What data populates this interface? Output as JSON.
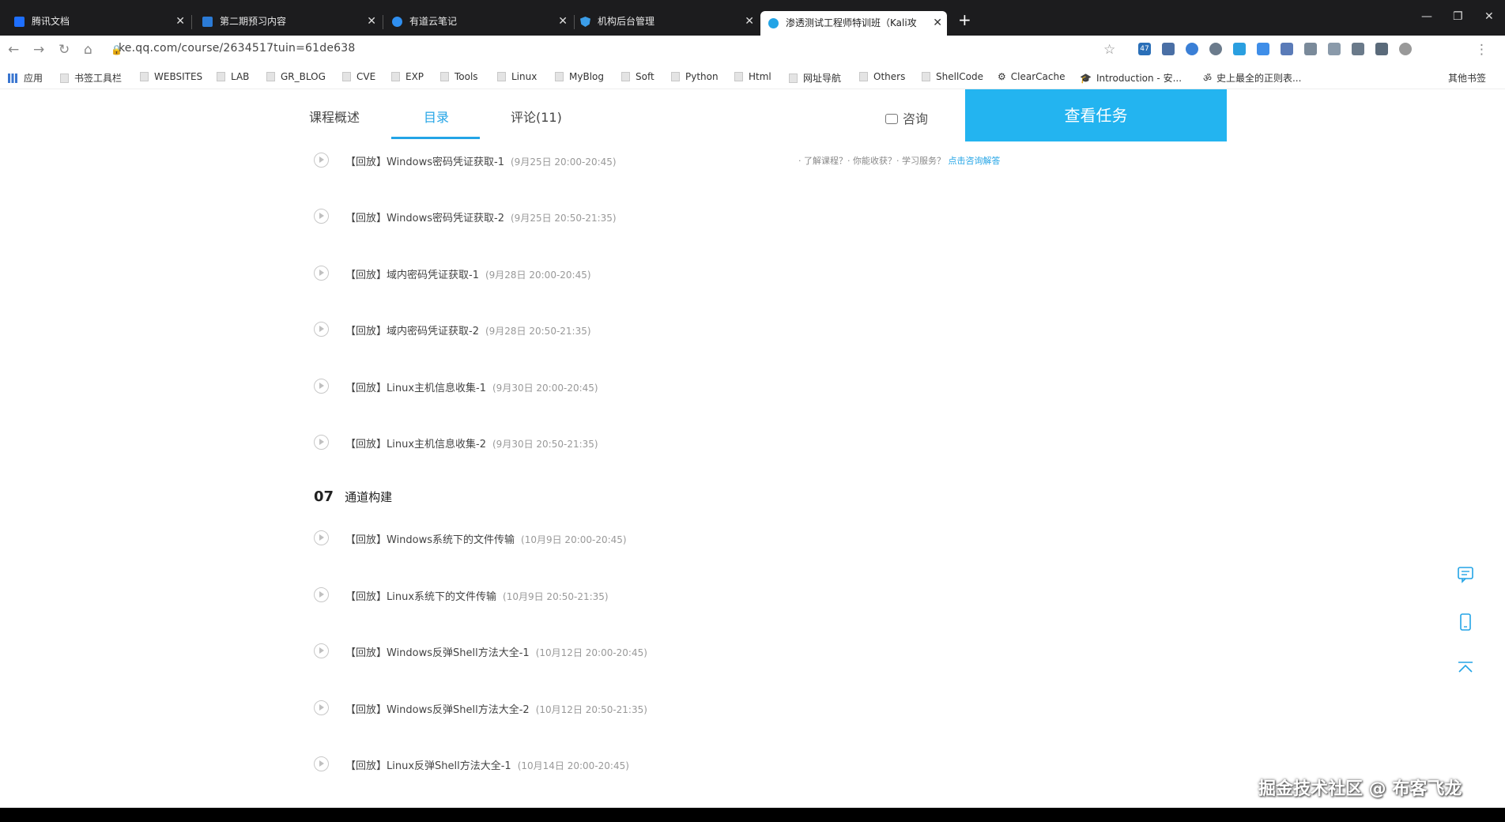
{
  "browser": {
    "tabs": [
      {
        "title": "腾讯文档",
        "icon": "tencent-docs-icon",
        "color": "#1e6fff"
      },
      {
        "title": "第二期预习内容",
        "icon": "doc-icon",
        "color": "#2b7bd6"
      },
      {
        "title": "有道云笔记",
        "icon": "youdao-note-icon",
        "color": "#2f8ff0"
      },
      {
        "title": "机构后台管理",
        "icon": "shield-icon",
        "color": "#3b9de8"
      },
      {
        "title": "渗透测试工程师特训班（Kali攻",
        "icon": "tencent-class-icon",
        "color": "#23a4e6",
        "active": true
      }
    ],
    "url": "ke.qq.com/course/2634517tuin=61de638",
    "bookmarks": [
      "应用",
      "书签工具栏",
      "WEBSITES",
      "LAB",
      "GR_BLOG",
      "CVE",
      "EXP",
      "Tools",
      "Linux",
      "MyBlog",
      "Soft",
      "Python",
      "Html",
      "网址导航",
      "Others",
      "ShellCode",
      "ClearCache",
      "Introduction - 安...",
      "史上最全的正则表...",
      "其他书签"
    ],
    "ext_badge": "47"
  },
  "course": {
    "subnav": [
      "课程概述",
      "目录",
      "评论(11)"
    ],
    "consult_label": "咨询",
    "view_task_label": "查看任务",
    "hint": {
      "items": "· 了解课程？· 你能收获？· 学习服务？",
      "link": "点击咨询解答"
    },
    "lessons_top": [
      {
        "title": "【回放】Windows密码凭证获取-1",
        "time": "(9月25日 20:00-20:45)"
      },
      {
        "title": "【回放】Windows密码凭证获取-2",
        "time": "(9月25日 20:50-21:35)"
      },
      {
        "title": "【回放】域内密码凭证获取-1",
        "time": "(9月28日 20:00-20:45)"
      },
      {
        "title": "【回放】域内密码凭证获取-2",
        "time": "(9月28日 20:50-21:35)"
      },
      {
        "title": "【回放】Linux主机信息收集-1",
        "time": "(9月30日 20:00-20:45)"
      },
      {
        "title": "【回放】Linux主机信息收集-2",
        "time": "(9月30日 20:50-21:35)"
      }
    ],
    "chapter": {
      "num": "07",
      "name": "通道构建"
    },
    "lessons_bottom": [
      {
        "title": "【回放】Windows系统下的文件传输",
        "time": "(10月9日 20:00-20:45)"
      },
      {
        "title": "【回放】Linux系统下的文件传输",
        "time": "(10月9日 20:50-21:35)"
      },
      {
        "title": "【回放】Windows反弹Shell方法大全-1",
        "time": "(10月12日 20:00-20:45)"
      },
      {
        "title": "【回放】Windows反弹Shell方法大全-2",
        "time": "(10月12日 20:50-21:35)"
      },
      {
        "title": "【回放】Linux反弹Shell方法大全-1",
        "time": "(10月14日 20:00-20:45)"
      }
    ]
  },
  "watermark": "掘金技术社区 @ 布客飞龙"
}
